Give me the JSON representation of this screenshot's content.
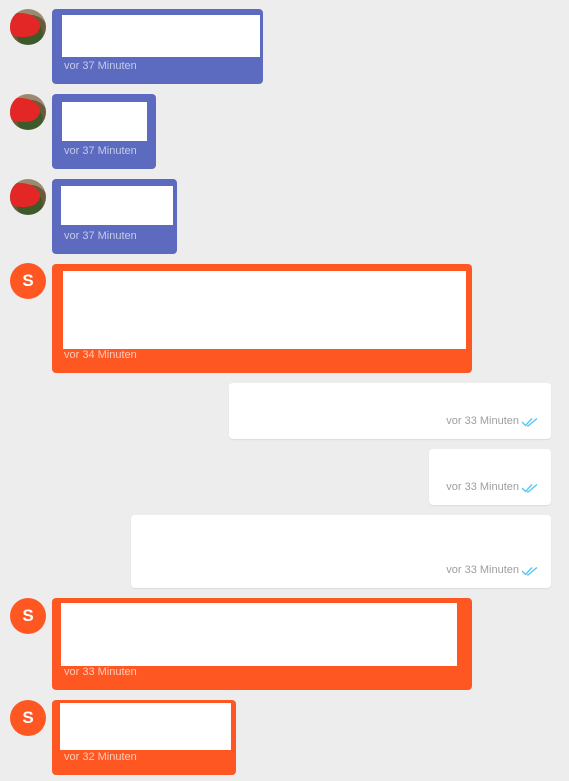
{
  "colors": {
    "incoming_agent": "#5c6bc0",
    "incoming_system": "#ff5722",
    "outgoing": "#ffffff",
    "background": "#ededed",
    "read_ticks": "#4fc3f7"
  },
  "messages": [
    {
      "direction": "incoming",
      "style": "blue",
      "avatar": "photo",
      "time": "vor 37 Minuten"
    },
    {
      "direction": "incoming",
      "style": "blue",
      "avatar": "photo",
      "time": "vor 37 Minuten"
    },
    {
      "direction": "incoming",
      "style": "blue",
      "avatar": "photo",
      "time": "vor 37 Minuten"
    },
    {
      "direction": "incoming",
      "style": "orange",
      "avatar": "S",
      "time": "vor 34 Minuten"
    },
    {
      "direction": "outgoing",
      "style": "white",
      "status_icon": "double-check-icon",
      "time": "vor 33 Minuten"
    },
    {
      "direction": "outgoing",
      "style": "white",
      "status_icon": "double-check-icon",
      "time": "vor 33 Minuten"
    },
    {
      "direction": "outgoing",
      "style": "white",
      "status_icon": "double-check-icon",
      "time": "vor 33 Minuten"
    },
    {
      "direction": "incoming",
      "style": "orange",
      "avatar": "S",
      "time": "vor 33 Minuten"
    },
    {
      "direction": "incoming",
      "style": "orange",
      "avatar": "S",
      "time": "vor 32 Minuten"
    }
  ]
}
